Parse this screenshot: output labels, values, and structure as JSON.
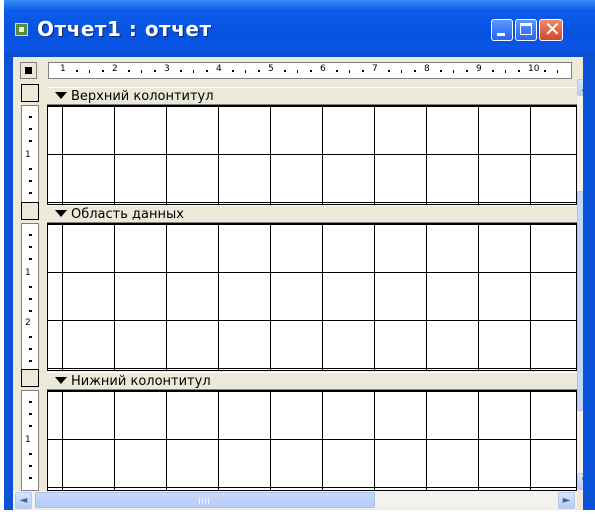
{
  "window": {
    "title": "Отчет1 : отчет",
    "titlebar_color": "#0a52d8",
    "icons": [
      "report-icon",
      "minimize-icon",
      "maximize-icon",
      "close-icon"
    ]
  },
  "ruler": {
    "horizontal_labels": [
      "1",
      "2",
      "3",
      "4",
      "5",
      "6",
      "7",
      "8",
      "9",
      "10"
    ],
    "unit": "cm"
  },
  "sections": [
    {
      "label": "Верхний колонтитул",
      "ruler_labels": [
        "1"
      ]
    },
    {
      "label": "Область данных",
      "ruler_labels": [
        "1",
        "2"
      ]
    },
    {
      "label": "Нижний колонтитул",
      "ruler_labels": [
        "1"
      ]
    }
  ],
  "scrollbars": {
    "up_arrow": "▲",
    "down_arrow": "▼",
    "left_arrow": "◄",
    "right_arrow": "►"
  },
  "colors": {
    "form_background": "#ece9d8",
    "grid_background": "#ffffff",
    "grid_lines": "#000000"
  }
}
